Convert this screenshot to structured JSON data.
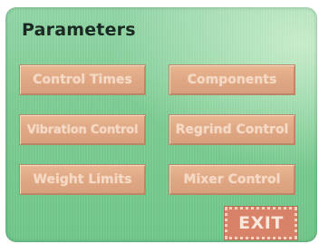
{
  "screen": {
    "title": "Parameters",
    "buttons": [
      {
        "label": "Control Times"
      },
      {
        "label": "Components"
      },
      {
        "label": "Vibration Control"
      },
      {
        "label": "Regrind Control"
      },
      {
        "label": "Weight Limits"
      },
      {
        "label": "Mixer Control"
      }
    ],
    "exit_label": "EXIT"
  },
  "colors": {
    "background": "#79c990",
    "button": "#dfa783",
    "button_text": "#f5d9c4",
    "exit_button": "#d88369",
    "title": "#1b2a22"
  }
}
